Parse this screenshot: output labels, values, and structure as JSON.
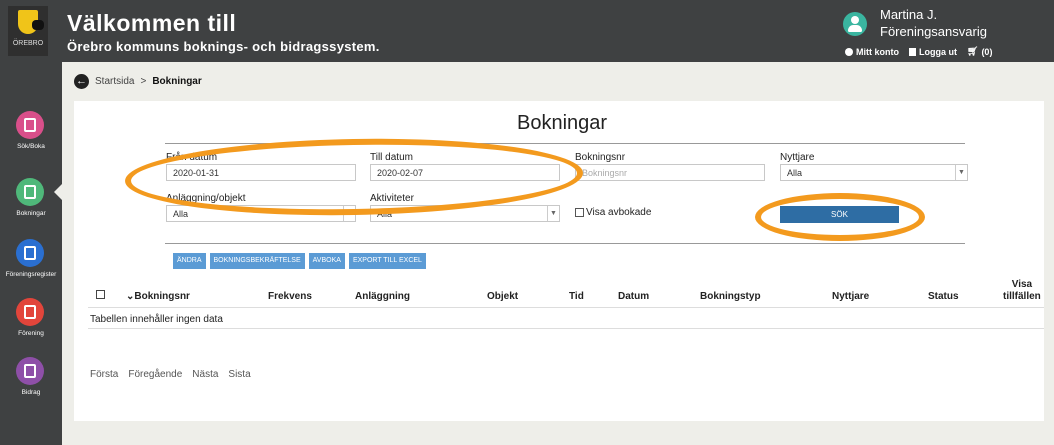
{
  "header": {
    "logo_text": "ÖREBRO",
    "title_line1": "Välkommen till",
    "title_line2": "Örebro kommuns boknings- och bidragssystem.",
    "user_name": "Martina J.",
    "user_role": "Föreningsansvarig",
    "my_account": "Mitt konto",
    "logout": "Logga ut",
    "cart": "(0)"
  },
  "sidebar": {
    "items": [
      {
        "label": "Sök/Boka",
        "color": "#d94f8a"
      },
      {
        "label": "Bokningar",
        "color": "#4fb87a"
      },
      {
        "label": "Föreningsregister",
        "color": "#2a6fd1"
      },
      {
        "label": "Förening",
        "color": "#e2453b"
      },
      {
        "label": "Bidrag",
        "color": "#8e4fa8"
      }
    ]
  },
  "breadcrumb": {
    "home": "Startsida",
    "separator": ">",
    "current": "Bokningar"
  },
  "page": {
    "title": "Bokningar",
    "from_date": {
      "label": "Från datum",
      "value": "2020-01-31"
    },
    "to_date": {
      "label": "Till datum",
      "value": "2020-02-07"
    },
    "booking_nr": {
      "label": "Bokningsnr",
      "placeholder": "Bokningsnr"
    },
    "user": {
      "label": "Nyttjare",
      "value": "Alla"
    },
    "facility": {
      "label": "Anläggning/objekt",
      "value": "Alla"
    },
    "activities": {
      "label": "Aktiviteter",
      "value": "Alla"
    },
    "show_cancelled": "Visa avbokade",
    "search_button": "SÖK"
  },
  "actions": [
    "ÄNDRA",
    "BOKNINGSBEKRÄFTELSE",
    "AVBOKA",
    "EXPORT TILL EXCEL"
  ],
  "table": {
    "headers": [
      "Bokningsnr",
      "Frekvens",
      "Anläggning",
      "Objekt",
      "Tid",
      "Datum",
      "Bokningstyp",
      "Nyttjare",
      "Status"
    ],
    "last_header_line1": "Visa",
    "last_header_line2": "tillfällen",
    "empty_text": "Tabellen innehåller ingen data"
  },
  "pager": [
    "Första",
    "Föregående",
    "Nästa",
    "Sista"
  ],
  "annotation_color": "#f39a1e"
}
